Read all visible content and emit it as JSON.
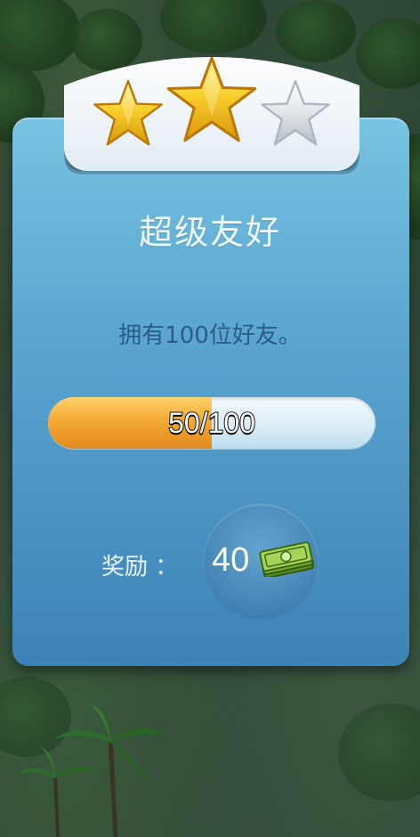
{
  "achievement": {
    "title": "超级友好",
    "description": "拥有100位好友。",
    "stars_earned": 2,
    "stars_total": 3
  },
  "progress": {
    "current": 50,
    "target": 100,
    "label": "50/100",
    "fill_color": "#f4a833"
  },
  "reward": {
    "label": "奖励 ：",
    "amount": "40",
    "icon": "cash-icon"
  },
  "colors": {
    "card_top": "#78c2e2",
    "card_bottom": "#3d82b8",
    "star_gold": "#f5c21a",
    "star_silver": "#d9dde2"
  }
}
